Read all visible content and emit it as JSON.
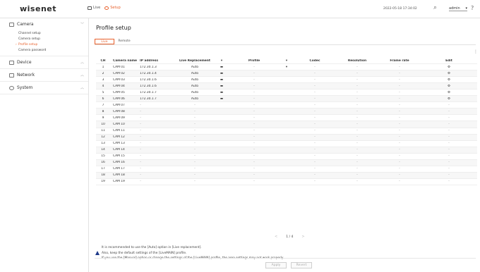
{
  "app": {
    "logo": "wisenet",
    "datetime": "2022-05-18 17:34:02",
    "user": "admin"
  },
  "top_tabs": [
    {
      "label": "Live",
      "active": false
    },
    {
      "label": "Setup",
      "active": true
    }
  ],
  "sidebar": {
    "sections": [
      {
        "label": "Camera",
        "icon": "camera-icon",
        "expanded": true,
        "items": [
          {
            "label": "Channel setup",
            "active": false
          },
          {
            "label": "Camera setup",
            "active": false
          },
          {
            "label": "Profile setup",
            "active": true
          },
          {
            "label": "Camera password",
            "active": false
          }
        ]
      },
      {
        "label": "Device",
        "icon": "device-icon",
        "expanded": false,
        "items": []
      },
      {
        "label": "Network",
        "icon": "network-icon",
        "expanded": false,
        "items": []
      },
      {
        "label": "System",
        "icon": "system-icon",
        "expanded": false,
        "items": []
      }
    ]
  },
  "main": {
    "title": "Profile setup",
    "subtabs": [
      {
        "label": "Live",
        "active": true
      },
      {
        "label": "Remote",
        "active": false
      }
    ],
    "columns": [
      "CH",
      "Camera name",
      "IP address",
      "Live Replacement",
      "",
      "Profile",
      "",
      "Codec",
      "Resolution",
      "Frame rate",
      "Edit"
    ],
    "rows": [
      [
        "1",
        "CAM 01",
        "172.30.1.3",
        "Auto",
        "▬",
        "–",
        "▾",
        "–",
        "–",
        "–",
        "⚙"
      ],
      [
        "2",
        "CAM 02",
        "172.30.1.4",
        "Auto",
        "▬",
        "–",
        "",
        "–",
        "–",
        "–",
        "⚙"
      ],
      [
        "3",
        "CAM 03",
        "172.30.1.6",
        "Auto",
        "▬",
        "–",
        "",
        "–",
        "–",
        "–",
        "⚙"
      ],
      [
        "4",
        "CAM 04",
        "172.30.1.6",
        "Auto",
        "▬",
        "–",
        "",
        "–",
        "–",
        "–",
        "⚙"
      ],
      [
        "5",
        "CAM 05",
        "172.30.1.7",
        "Auto",
        "▬",
        "–",
        "",
        "–",
        "–",
        "–",
        "⚙"
      ],
      [
        "6",
        "CAM 06",
        "172.30.1.7",
        "Auto",
        "▬",
        "–",
        "",
        "–",
        "–",
        "–",
        "⚙"
      ],
      [
        "7",
        "CAM 07",
        "–",
        "–",
        "",
        "–",
        "",
        "–",
        "–",
        "–",
        "–"
      ],
      [
        "8",
        "CAM 08",
        "–",
        "–",
        "",
        "–",
        "",
        "–",
        "–",
        "–",
        "–"
      ],
      [
        "9",
        "CAM 09",
        "–",
        "–",
        "",
        "–",
        "",
        "–",
        "–",
        "–",
        "–"
      ],
      [
        "10",
        "CAM 10",
        "–",
        "–",
        "",
        "–",
        "",
        "–",
        "–",
        "–",
        "–"
      ],
      [
        "11",
        "CAM 11",
        "–",
        "–",
        "",
        "–",
        "",
        "–",
        "–",
        "–",
        "–"
      ],
      [
        "12",
        "CAM 12",
        "–",
        "–",
        "",
        "–",
        "",
        "–",
        "–",
        "–",
        "–"
      ],
      [
        "13",
        "CAM 13",
        "–",
        "–",
        "",
        "–",
        "",
        "–",
        "–",
        "–",
        "–"
      ],
      [
        "14",
        "CAM 14",
        "–",
        "–",
        "",
        "–",
        "",
        "–",
        "–",
        "–",
        "–"
      ],
      [
        "15",
        "CAM 15",
        "–",
        "–",
        "",
        "–",
        "",
        "–",
        "–",
        "–",
        "–"
      ],
      [
        "16",
        "CAM 16",
        "–",
        "–",
        "",
        "–",
        "",
        "–",
        "–",
        "–",
        "–"
      ],
      [
        "17",
        "CAM 17",
        "–",
        "–",
        "",
        "–",
        "",
        "–",
        "–",
        "–",
        "–"
      ],
      [
        "18",
        "CAM 18",
        "–",
        "–",
        "",
        "–",
        "",
        "–",
        "–",
        "–",
        "–"
      ],
      [
        "19",
        "CAM 19",
        "–",
        "–",
        "",
        "–",
        "",
        "–",
        "–",
        "–",
        "–"
      ]
    ],
    "pagination": {
      "prev": "<",
      "label": "1 / 4",
      "next": ">"
    },
    "notes": [
      "It is recommended to use the [Auto] option in [Live replacement].",
      "Also, keep the default settings of the [LiveMAIN] profile.",
      "If you use the [Manual] option or change the settings of the [LiveMAIN] profile, the area settings may not work properly."
    ],
    "buttons": {
      "apply": "Apply",
      "revert": "Revert"
    }
  },
  "colors": {
    "accent": "#e8612c",
    "warning_icon": "#1e3a8a"
  }
}
